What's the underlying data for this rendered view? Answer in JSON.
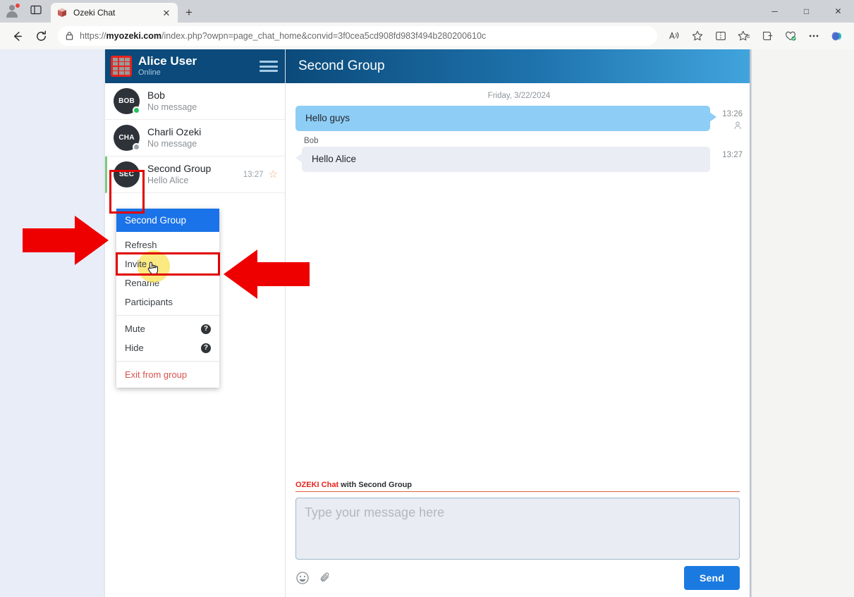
{
  "browser": {
    "tab": {
      "title": "Ozeki Chat",
      "favicon": "cube-icon",
      "close": "✕"
    },
    "new_tab_label": "+",
    "window_controls": {
      "minimize": "─",
      "maximize": "□",
      "close": "✕"
    },
    "nav": {
      "back": "back-arrow-icon",
      "reload": "reload-icon"
    },
    "address": {
      "lock": "lock-icon",
      "scheme": "https://",
      "domain": "myozeki.com",
      "path": "/index.php?owpn=page_chat_home&convid=3f0cea5cd908fd983f494b280200610c",
      "full_url": "https://myozeki.com/index.php?owpn=page_chat_home&convid=3f0cea5cd908fd983f494b280200610c"
    },
    "toolbar_icons": [
      "read-aloud-icon",
      "favorite-star-icon",
      "split-screen-icon",
      "collections-icon",
      "add-to-collections-icon",
      "browser-essentials-icon",
      "settings-more-icon",
      "copilot-icon"
    ]
  },
  "sidebar": {
    "user": {
      "name": "Alice User",
      "status": "Online",
      "logo": "ozeki-grid-logo"
    },
    "menu_icon": "hamburger-icon",
    "contacts": [
      {
        "initials": "BOB",
        "name": "Bob",
        "preview": "No message",
        "time": "",
        "presence": "online",
        "starred": false,
        "selected": false
      },
      {
        "initials": "CHA",
        "name": "Charli Ozeki",
        "preview": "No message",
        "time": "",
        "presence": "offline",
        "starred": false,
        "selected": false
      },
      {
        "initials": "SEC",
        "name": "Second Group",
        "preview": "Hello Alice",
        "time": "13:27",
        "presence": "none",
        "starred": true,
        "selected": true
      }
    ]
  },
  "context_menu": {
    "title": "Second Group",
    "groups": [
      {
        "items": [
          {
            "label": "Refresh",
            "help": false,
            "danger": false,
            "highlighted": false
          },
          {
            "label": "Invite",
            "help": false,
            "danger": false,
            "highlighted": true
          },
          {
            "label": "Rename",
            "help": false,
            "danger": false,
            "highlighted": false
          },
          {
            "label": "Participants",
            "help": false,
            "danger": false,
            "highlighted": false
          }
        ]
      },
      {
        "items": [
          {
            "label": "Mute",
            "help": true,
            "danger": false,
            "highlighted": false
          },
          {
            "label": "Hide",
            "help": true,
            "danger": false,
            "highlighted": false
          }
        ]
      },
      {
        "items": [
          {
            "label": "Exit from group",
            "help": false,
            "danger": true,
            "highlighted": false
          }
        ]
      }
    ],
    "help_glyph": "?"
  },
  "chat": {
    "header_title": "Second Group",
    "date_separator": "Friday, 3/22/2024",
    "messages": [
      {
        "direction": "out",
        "sender": "",
        "text": "Hello guys",
        "time": "13:26",
        "read_icon": "person-read-icon"
      },
      {
        "direction": "in",
        "sender": "Bob",
        "text": "Hello Alice",
        "time": "13:27",
        "read_icon": ""
      }
    ]
  },
  "composer": {
    "label_brand": "OZEKI Chat",
    "label_rest": " with Second Group",
    "placeholder": "Type your message here",
    "value": "",
    "emoji_icon": "emoji-icon",
    "attach_icon": "paperclip-icon",
    "send_label": "Send"
  },
  "annotations": {
    "arrow_color": "#ee0000",
    "highlight_color": "#e00000",
    "arrows": [
      {
        "name": "arrow-to-second-group",
        "direction": "right"
      },
      {
        "name": "arrow-to-invite",
        "direction": "left"
      }
    ],
    "cursor": "pointing-hand-cursor"
  },
  "colors": {
    "brand_red": "#e8231d",
    "header_navy": "#0b4a7a",
    "menu_blue": "#1a73e8",
    "send_blue": "#1a7ae0",
    "bubble_out": "#8ecdf5",
    "bubble_in": "#eaedf3",
    "danger_red": "#d9534f",
    "page_bg": "#e8edf7"
  }
}
